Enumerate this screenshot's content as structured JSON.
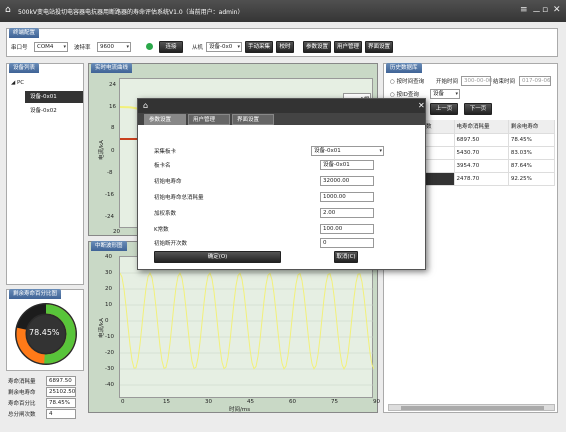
{
  "title": "500kV变电站投切电容器电抗器用断路器的寿命评估系统V1.0（当前用户：admin）",
  "window_icons": [
    "≡",
    "－",
    "▫",
    "✕"
  ],
  "comm": {
    "header": "终端配置",
    "port_label": "串口号",
    "port_value": "COM4",
    "baud_label": "波特率",
    "baud_value": "9600",
    "connect": "连接",
    "slave_label": "从机",
    "slave_value": "设备-0x0",
    "manual": "手动采集",
    "calib": "校时",
    "param": "参数设置",
    "user": "用户管理",
    "ui": "界面设置"
  },
  "device_list": {
    "header": "设备列表",
    "root": "PC",
    "items": [
      "设备-0x01",
      "设备-0x02"
    ]
  },
  "realtime": {
    "header": "实时电流曲线",
    "legend": "A相",
    "yticks": [
      "24",
      "16",
      "8",
      "0",
      "-8",
      "-16",
      "-24"
    ],
    "ylabel": "电流/kA",
    "xtick0": "20"
  },
  "middle": {
    "header": "中断波形图",
    "ylabel": "电流/kA",
    "yticks": [
      "40",
      "30",
      "20",
      "10",
      "0",
      "-10",
      "-20",
      "-30",
      "-40"
    ],
    "xticks": [
      "0",
      "15",
      "30",
      "45",
      "60",
      "75",
      "90"
    ],
    "xlabel": "时间/ms"
  },
  "life": {
    "header": "剩余寿命百分比图",
    "percent": "78.45%"
  },
  "stats": [
    {
      "label": "寿命消耗量",
      "value": "6897.50"
    },
    {
      "label": "剩余电寿命",
      "value": "25102.50"
    },
    {
      "label": "寿命百分比",
      "value": "78.45%"
    },
    {
      "label": "总分闸次数",
      "value": "4"
    }
  ],
  "history": {
    "header": "历史数据库",
    "by_time": "按时间查询",
    "start_label": "开始时间",
    "start_value": "300-00-00",
    "end_label": "结束时间",
    "end_value": "017-09-06",
    "by_dev": "按ID查询",
    "dev_value": "设备",
    "prev": "上一页",
    "next": "下一页",
    "cols": [
      "数",
      "电寿命消耗量",
      "剩余电寿命"
    ],
    "rows": [
      [
        "",
        "6897.50",
        "78.45%"
      ],
      [
        "",
        "5430.70",
        "83.03%"
      ],
      [
        "",
        "3954.70",
        "87.64%"
      ],
      [
        "",
        "2478.70",
        "92.25%"
      ]
    ]
  },
  "dialog": {
    "tabs": [
      "参数设置",
      "用户管理",
      "界面设置"
    ],
    "fields": [
      {
        "label": "采集板卡",
        "value": "设备-0x01"
      },
      {
        "label": "板卡名",
        "value": "设备-0x01"
      },
      {
        "label": "初始电寿命",
        "value": "32000.00"
      },
      {
        "label": "初始电寿命总消耗量",
        "value": "1000.00"
      },
      {
        "label": "加权系数",
        "value": "2.00"
      },
      {
        "label": "K常数",
        "value": "100.00"
      },
      {
        "label": "初始断开次数",
        "value": "0"
      }
    ],
    "ok": "确定(O)",
    "cancel": "取消(C)"
  },
  "colors": {
    "accent": "#3f6396",
    "wave": "#f2f07a",
    "red": "#c8401e",
    "chart_bg": "#c9d9c6",
    "green": "#2ba84a"
  }
}
